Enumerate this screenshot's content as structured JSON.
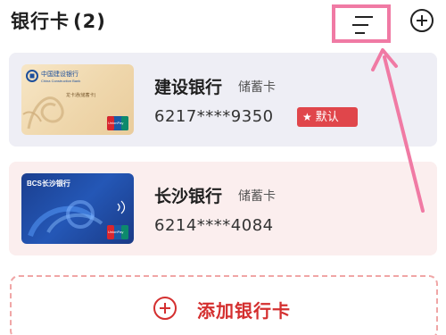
{
  "header": {
    "title": "银行卡",
    "count": "(2)",
    "menu_icon": "menu-lines-icon",
    "add_icon": "plus-circle-icon"
  },
  "cards": [
    {
      "bank": "建设银行",
      "type": "储蓄卡",
      "number": "6217****9350",
      "badge": "默认",
      "card_art": {
        "bank_logo_text": "中国建设银行",
        "bank_logo_en": "China Construction Bank",
        "product": "龙卡通(储蓄卡)",
        "network": "UnionPay 银联"
      },
      "colors": {
        "row_bg": "#eeeef5",
        "badge_bg": "#e0464b"
      }
    },
    {
      "bank": "长沙银行",
      "type": "储蓄卡",
      "number": "6214****4084",
      "card_art": {
        "bank_logo_text": "BCS长沙银行",
        "network": "UnionPay 银联"
      },
      "colors": {
        "row_bg": "#fbeeee"
      }
    }
  ],
  "add_card": {
    "label": "添加银行卡"
  },
  "colors": {
    "accent": "#d42f2f",
    "highlight": "#f07aa4"
  }
}
